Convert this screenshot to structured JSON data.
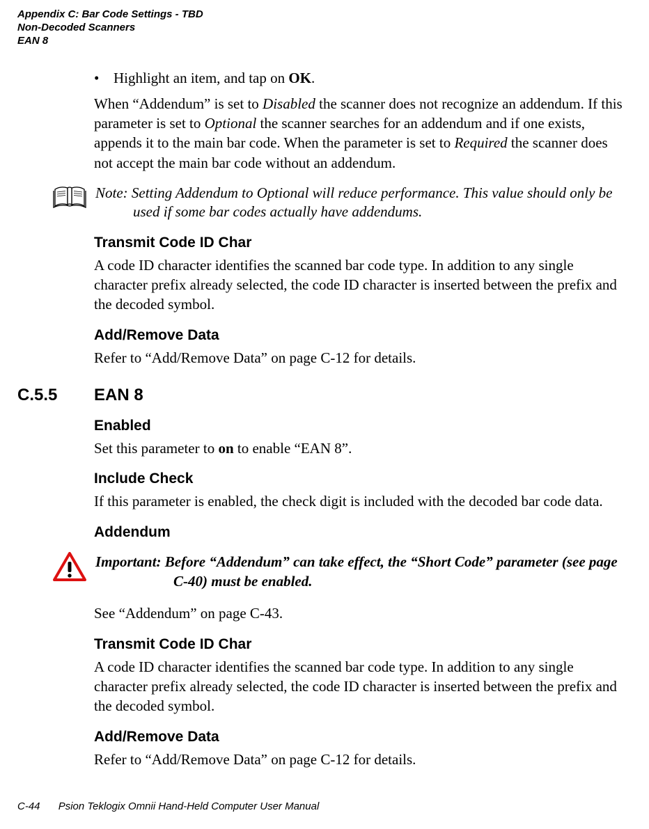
{
  "header": {
    "line1": "Appendix C: Bar Code Settings - TBD",
    "line2": "Non-Decoded Scanners",
    "line3": "EAN 8"
  },
  "bullet1_pre": "Highlight an item, and tap on ",
  "bullet1_bold": "OK",
  "bullet1_post": ".",
  "addendum_para": {
    "p1_a": "When “Addendum” is set to ",
    "p1_b": "Disabled",
    "p1_c": " the scanner does not recognize an addendum. If this parameter is set to ",
    "p1_d": "Optional",
    "p1_e": " the scanner searches for an addendum and if one exists, appends it to the main bar code. When the parameter is set to ",
    "p1_f": "Required",
    "p1_g": " the scanner does not accept the main bar code without an addendum."
  },
  "note1": "Note: Setting Addendum to Optional will reduce performance. This value should only be used if some bar codes actually have addendums.",
  "h_transmit": "Transmit Code ID Char",
  "p_transmit": "A code ID character identifies the scanned bar code type. In addition to any single character prefix already selected, the code ID character is inserted between the prefix and the decoded symbol.",
  "h_addremove": "Add/Remove Data",
  "p_addremove": "Refer to “Add/Remove Data” on page C-12 for details.",
  "section": {
    "number": "C.5.5",
    "title": "EAN 8"
  },
  "h_enabled": "Enabled",
  "p_enabled_a": "Set this parameter to ",
  "p_enabled_b": "on",
  "p_enabled_c": " to enable “EAN 8”.",
  "h_include": "Include Check",
  "p_include": "If this parameter is enabled, the check digit is included with the decoded bar code data.",
  "h_addendum": "Addendum",
  "important1": "Important:  Before “Addendum” can take effect, the “Short Code” parameter (see page C-40) must be enabled.",
  "p_seeaddendum": "See “Addendum” on page C-43.",
  "footer": {
    "page": "C-44",
    "title": "Psion Teklogix Omnii Hand-Held Computer User Manual"
  }
}
